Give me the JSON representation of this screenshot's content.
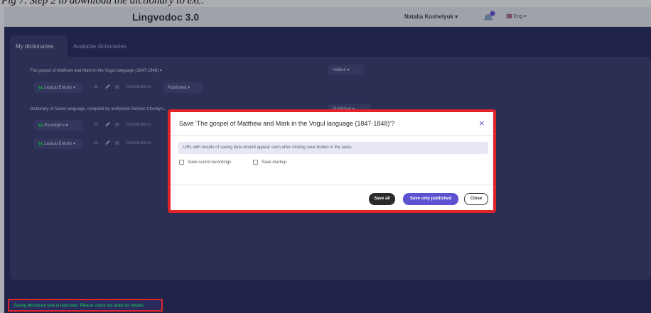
{
  "caption": "Fig 7. Step 2 to download the dictionary to exc.",
  "header": {
    "logo": "Lingvodoc 3.0",
    "user": "Natalia Koshelyuk ▾",
    "language": "🇬🇧 Eng ▾"
  },
  "tabs": [
    "My dictionaries",
    "Available dictionaries"
  ],
  "dictionaries": [
    {
      "title": "The gospel of Matthew and Mark in the Vogul language (1847-1848) ▾",
      "status": "Hidden ▾",
      "perspective": "Lexical Entries ▾",
      "contributions": "Contributions",
      "pstatus": "Published ▾"
    },
    {
      "title": "Dictionary of Mansi language, compiled by archpriest Simeon Cherdyn...",
      "status": "Published ▾",
      "perspectives": [
        {
          "name": "Paradigms ▾",
          "contributions": "Contributions"
        },
        {
          "name": "Lexical Entries ▾",
          "contributions": "Contributions"
        }
      ]
    }
  ],
  "modal": {
    "title": "Save 'The gospel of Matthew and Mark in the Vogul language (1847-1848)'?",
    "close_icon": "×",
    "message": "URL with results of saving data should appear soon after clicking save button in the tasks.",
    "checkbox_sound": "Save sound recordings",
    "checkbox_markup": "Save markup",
    "save_all": "Save all",
    "save_published": "Save only published",
    "close": "Close"
  },
  "toast": "Saving dictionary task is launched. Please check out tasks for details.",
  "colors": {
    "background": "#282b5c",
    "panel": "#393c6c",
    "accent": "#5c52d1",
    "highlight": "#e02429",
    "toast_text": "#1fcf5c"
  }
}
